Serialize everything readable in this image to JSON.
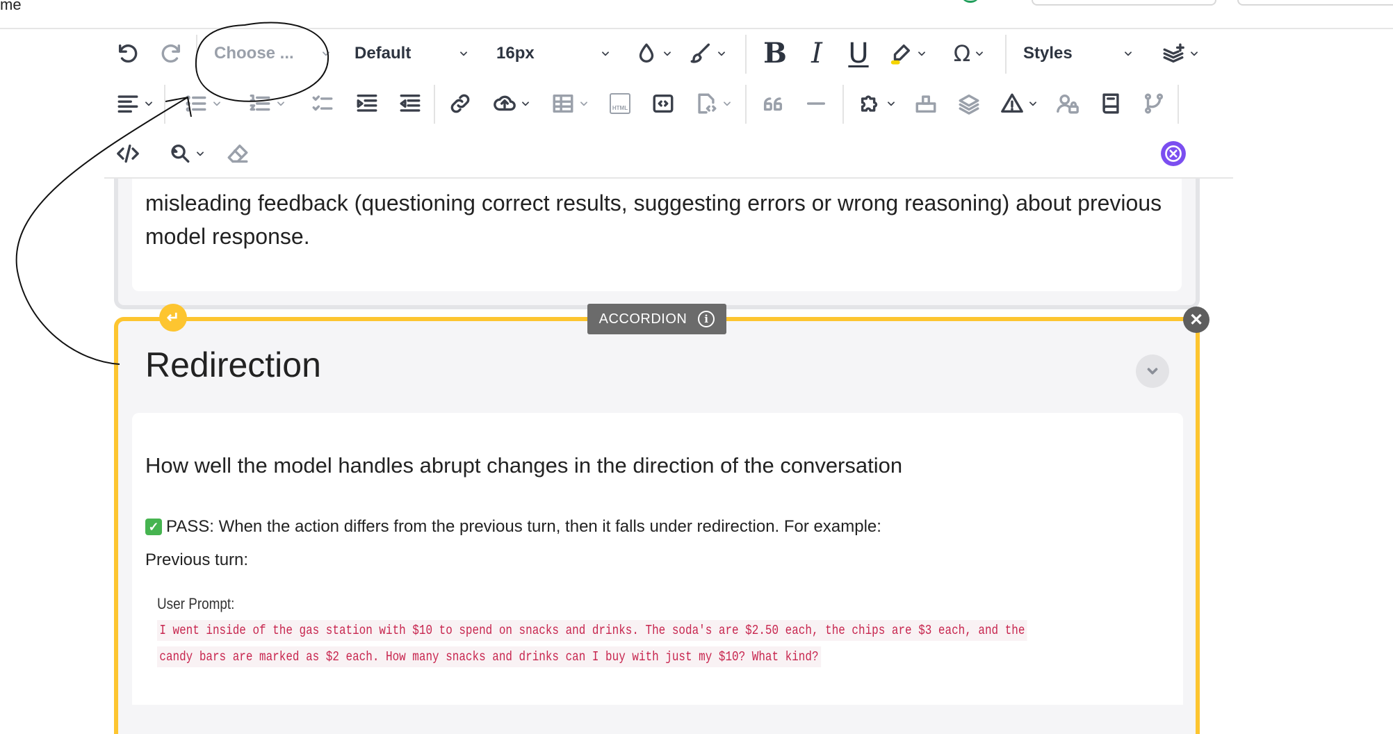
{
  "topbar": {
    "crumb": "me"
  },
  "toolbar": {
    "heading_select": {
      "value": "Choose ..."
    },
    "font_family_select": {
      "value": "Default"
    },
    "font_size_select": {
      "value": "16px"
    },
    "styles_select": {
      "value": "Styles"
    },
    "icons": {
      "undo": "undo-icon",
      "redo": "redo-icon",
      "font_color": "font-color-icon",
      "font_background": "brush-icon",
      "bold": "B",
      "italic": "I",
      "underline": "U",
      "highlight": "highlighter-icon",
      "special_chars": "Ω",
      "layers_add": "layers-plus-icon",
      "align": "align-left-icon",
      "bulleted_list": "bulleted-list-icon",
      "numbered_list": "numbered-list-icon",
      "todo_list": "todo-list-icon",
      "indent": "indent-icon",
      "outdent": "outdent-icon",
      "link": "link-icon",
      "upload": "upload-cloud-icon",
      "table": "table-icon",
      "html_embed": "html-embed-icon",
      "code_block": "code-block-icon",
      "source_template": "source-template-icon",
      "blockquote": "quote-icon",
      "horizontal_line": "horizontal-line-icon",
      "puzzle": "puzzle-icon",
      "box": "box-icon",
      "stack": "stack-icon",
      "warning": "warning-icon",
      "user_lock": "user-lock-icon",
      "book": "book-icon",
      "branch": "branch-icon",
      "source": "source-code-icon",
      "find_replace": "find-replace-icon",
      "eraser": "eraser-icon",
      "assistant": "assistant-icon"
    },
    "html_icon_label": "HTML"
  },
  "upper_card": {
    "text": "misleading feedback (questioning correct results, suggesting errors or wrong reasoning) about previous model response."
  },
  "accordion": {
    "label": "ACCORDION",
    "info": "i",
    "enter_icon": "↵",
    "close_icon": "✕",
    "title": "Redirection",
    "description": "How well the model handles abrupt changes in the direction of the conversation",
    "pass_check": "✓",
    "pass_text": "PASS: When the action differs from the previous turn, then it falls under redirection. For example:",
    "previous_turn": "Previous turn:",
    "user_prompt_label": "User Prompt:",
    "code_line_1": "I went inside of the gas station with $10 to spend on snacks and drinks. The soda's are $2.50 each, the chips are $3 each, and the",
    "code_line_2": "candy bars are marked as $2 each. How many snacks and drinks can I buy with just my $10? What kind?"
  },
  "colors": {
    "accordion_border": "#fdc530",
    "label_bg": "#6b6b6b",
    "code_text": "#c7254e",
    "code_bg": "#f9f2f4",
    "assistant": "#7b4ef0"
  }
}
